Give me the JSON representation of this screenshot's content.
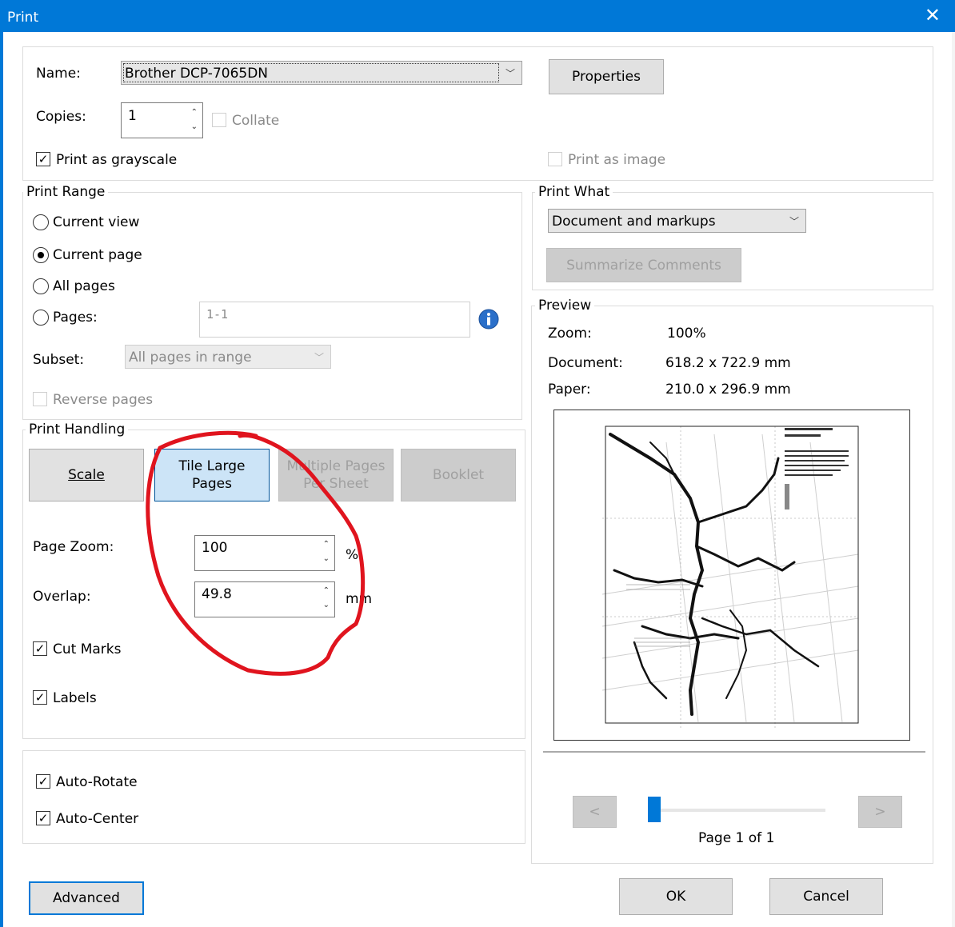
{
  "window": {
    "title": "Print",
    "close_glyph": "✕"
  },
  "printer": {
    "name_label": "Name:",
    "name_value": "Brother DCP-7065DN",
    "properties_label": "Properties",
    "copies_label": "Copies:",
    "copies_value": "1",
    "collate_label": "Collate",
    "collate_checked": false,
    "grayscale_label": "Print as grayscale",
    "grayscale_checked": true,
    "as_image_label": "Print as image",
    "as_image_checked": false
  },
  "print_range": {
    "legend": "Print Range",
    "options": [
      {
        "label": "Current view",
        "selected": false
      },
      {
        "label": "Current page",
        "selected": true
      },
      {
        "label": "All pages",
        "selected": false
      },
      {
        "label": "Pages:",
        "selected": false
      }
    ],
    "pages_value": "1-1",
    "subset_label": "Subset:",
    "subset_value": "All pages in range",
    "reverse_label": "Reverse pages",
    "reverse_checked": false
  },
  "print_what": {
    "legend": "Print What",
    "value": "Document and markups",
    "summarize_label": "Summarize Comments"
  },
  "print_handling": {
    "legend": "Print Handling",
    "tabs": [
      {
        "label": "Scale",
        "state": "normal"
      },
      {
        "label": "Tile Large Pages",
        "state": "selected"
      },
      {
        "label": "Multiple Pages Per Sheet",
        "state": "disabled"
      },
      {
        "label": "Booklet",
        "state": "disabled"
      }
    ],
    "page_zoom_label": "Page Zoom:",
    "page_zoom_value": "100",
    "page_zoom_unit": "%",
    "overlap_label": "Overlap:",
    "overlap_value": "49.8",
    "overlap_unit": "mm",
    "cut_marks_label": "Cut Marks",
    "cut_marks_checked": true,
    "labels_label": "Labels",
    "labels_checked": true
  },
  "orientation": {
    "auto_rotate_label": "Auto-Rotate",
    "auto_rotate_checked": true,
    "auto_center_label": "Auto-Center",
    "auto_center_checked": true
  },
  "preview": {
    "legend": "Preview",
    "zoom_label": "Zoom:",
    "zoom_value": "100%",
    "document_label": "Document:",
    "document_value": "618.2 x 722.9 mm",
    "paper_label": "Paper:",
    "paper_value": "210.0 x 296.9 mm",
    "prev_label": "<",
    "next_label": ">",
    "page_indicator": "Page 1 of 1",
    "slider_position": 0
  },
  "footer": {
    "advanced_label": "Advanced",
    "ok_label": "OK",
    "cancel_label": "Cancel"
  },
  "colors": {
    "titlebar": "#0078d7",
    "selected_tab": "#cce4f7",
    "annotation_red": "#e0141e",
    "slider_thumb": "#0078d7"
  },
  "icons": {
    "info": "info-icon",
    "chevron": "chevron-down-icon"
  }
}
